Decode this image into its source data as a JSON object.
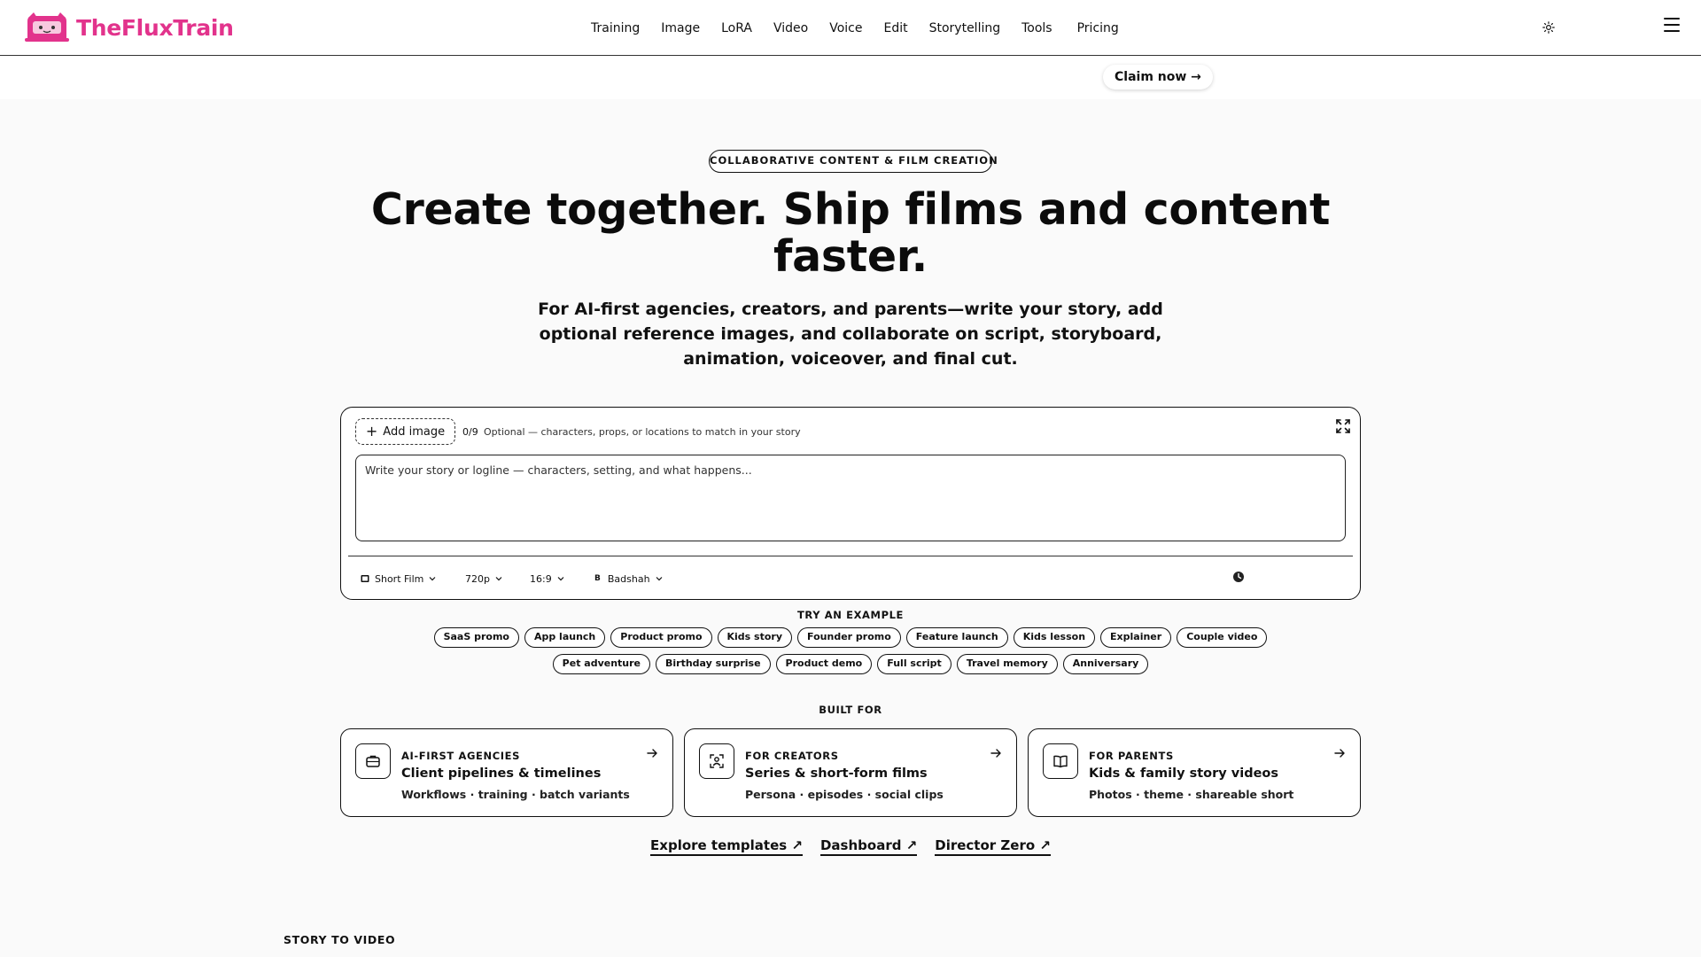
{
  "header": {
    "brand": "TheFluxTrain",
    "brand_color": "#e2338c",
    "nav": [
      "Training",
      "Image",
      "LoRA",
      "Video",
      "Voice",
      "Edit",
      "Storytelling",
      "Tools",
      "Pricing"
    ],
    "theme_icon": "sun-icon",
    "menu_icon": "hamburger-menu-icon"
  },
  "banner": {
    "claim_label": "Claim now →"
  },
  "hero": {
    "pill": "COLLABORATIVE CONTENT & FILM CREATION",
    "title": "Create together. Ship films and content faster.",
    "subtitle": "For AI-first agencies, creators, and parents—write your story, add optional reference images, and collaborate on script, storyboard, animation, voiceover, and final cut."
  },
  "prompt": {
    "add_image_label": "Add image",
    "image_count": "0/9",
    "image_hint": "Optional — characters, props, or locations to match in your story",
    "placeholder": "Write your story or logline — characters, setting, and what happens...",
    "format": "Short Film",
    "resolution": "720p",
    "aspect": "16:9",
    "voice": "Badshah",
    "voice_badge": "B"
  },
  "examples": {
    "label": "TRY AN EXAMPLE",
    "row1": [
      "SaaS promo",
      "App launch",
      "Product promo",
      "Kids story",
      "Founder promo",
      "Feature launch",
      "Kids lesson",
      "Explainer",
      "Couple video"
    ],
    "row2": [
      "Pet adventure",
      "Birthday surprise",
      "Product demo",
      "Full script",
      "Travel memory",
      "Anniversary"
    ]
  },
  "built_for": {
    "label": "BUILT FOR",
    "cards": [
      {
        "kicker": "AI-FIRST AGENCIES",
        "title": "Client pipelines & timelines",
        "sub": "Workflows · training · batch variants",
        "icon": "briefcase-icon"
      },
      {
        "kicker": "FOR CREATORS",
        "title": "Series & short-form films",
        "sub": "Persona · episodes · social clips",
        "icon": "person-scan-icon"
      },
      {
        "kicker": "FOR PARENTS",
        "title": "Kids & family story videos",
        "sub": "Photos · theme · shareable short",
        "icon": "book-icon"
      }
    ]
  },
  "links": [
    "Explore templates ↗",
    "Dashboard ↗",
    "Director Zero ↗"
  ],
  "story_section_label": "STORY TO VIDEO"
}
